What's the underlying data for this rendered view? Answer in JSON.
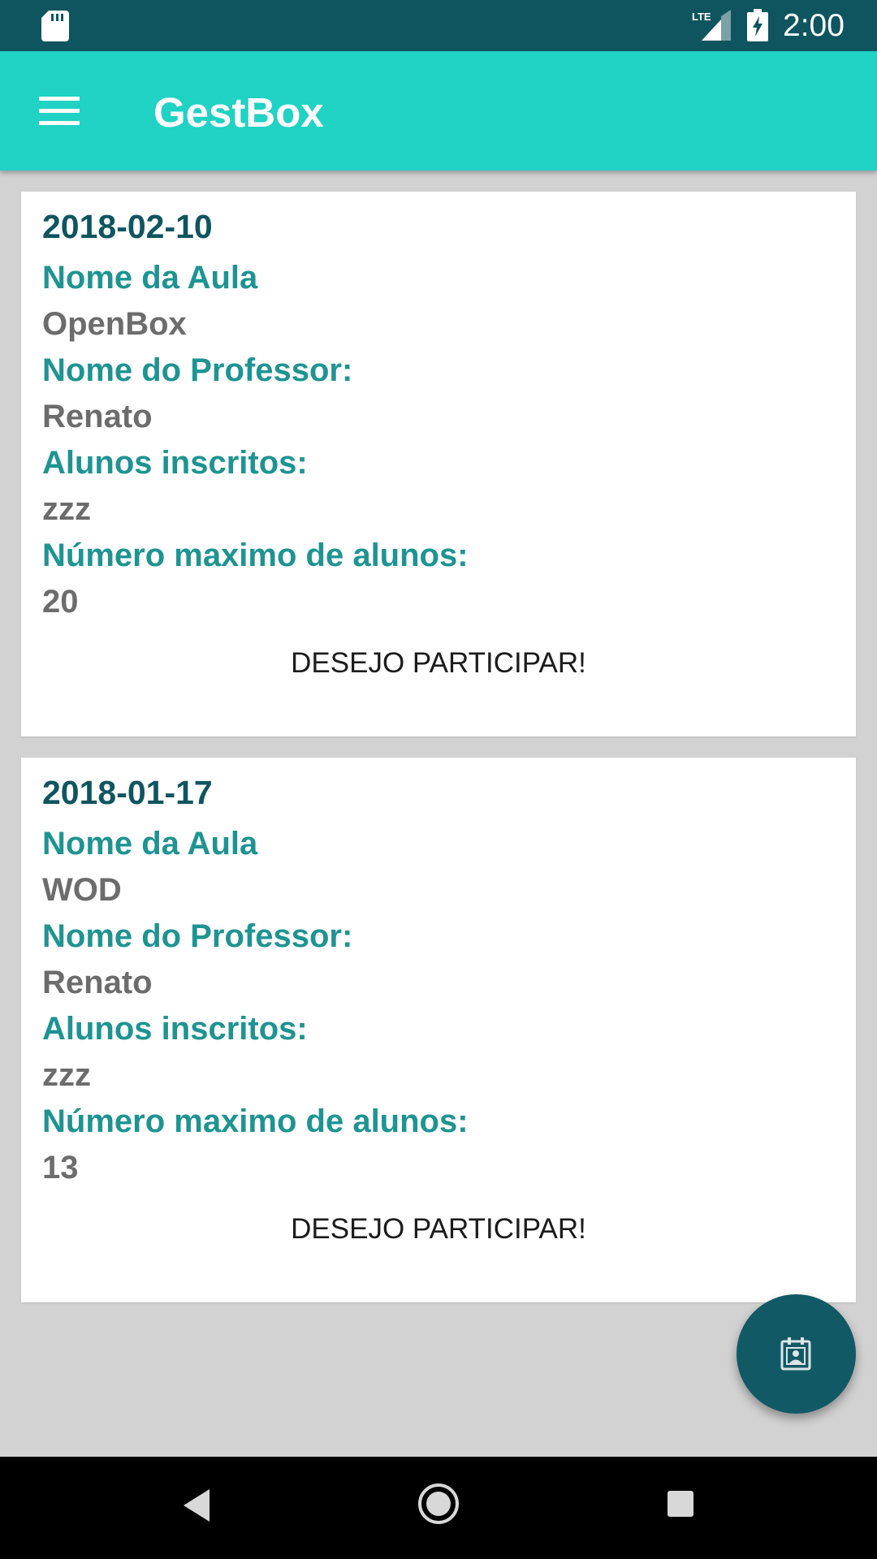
{
  "status_bar": {
    "time": "2:00",
    "network_label": "LTE",
    "icons": [
      "sd-card-icon",
      "lte-signal-icon",
      "battery-charging-icon"
    ]
  },
  "app_bar": {
    "title": "GestBox",
    "menu_icon": "hamburger-menu-icon"
  },
  "classes": [
    {
      "date": "2018-02-10",
      "class_name_label": "Nome da Aula",
      "class_name": "OpenBox",
      "teacher_label": "Nome do Professor:",
      "teacher": "Renato",
      "students_label": "Alunos inscritos:",
      "students": "zzz",
      "max_students_label": "Número maximo de alunos:",
      "max_students": "20",
      "join_label": "DESEJO PARTICIPAR!"
    },
    {
      "date": "2018-01-17",
      "class_name_label": "Nome da Aula",
      "class_name": "WOD",
      "teacher_label": "Nome do Professor:",
      "teacher": "Renato",
      "students_label": "Alunos inscritos:",
      "students": "zzz",
      "max_students_label": "Número maximo de alunos:",
      "max_students": "13",
      "join_label": "DESEJO PARTICIPAR!"
    }
  ],
  "fab": {
    "icon": "calendar-person-icon"
  },
  "nav_bar": {
    "icons": [
      "back-icon",
      "home-icon",
      "recents-icon"
    ]
  },
  "colors": {
    "status_bar": "#0f5560",
    "app_bar": "#1fd2c3",
    "background": "#d2d2d2",
    "date_text": "#0f5560",
    "label_text": "#1e9492",
    "value_text": "#6c6c6c",
    "fab": "#125966"
  }
}
